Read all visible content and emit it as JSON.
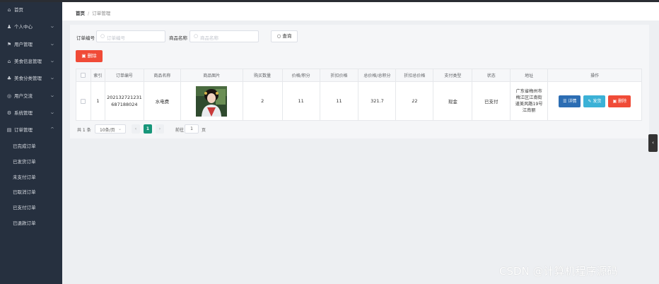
{
  "sidebar": {
    "items": [
      {
        "label": "首页",
        "icon": "home-icon",
        "glyph": "⌂",
        "chevron": ""
      },
      {
        "label": "个人中心",
        "icon": "user-icon",
        "glyph": "♟",
        "chevron": "⌄"
      },
      {
        "label": "用户管理",
        "icon": "flag-icon",
        "glyph": "⚑",
        "chevron": "⌄"
      },
      {
        "label": "美食信息管理",
        "icon": "food-icon",
        "glyph": "⌂",
        "chevron": "⌄"
      },
      {
        "label": "美食分类管理",
        "icon": "category-icon",
        "glyph": "♣",
        "chevron": "⌄"
      },
      {
        "label": "用户交流",
        "icon": "chat-icon",
        "glyph": "◎",
        "chevron": "⌄"
      },
      {
        "label": "系统管理",
        "icon": "settings-icon",
        "glyph": "⚙",
        "chevron": "⌄"
      },
      {
        "label": "订单管理",
        "icon": "order-icon",
        "glyph": "▤",
        "chevron": "⌃"
      }
    ],
    "sub_items": [
      "已完成订单",
      "已发货订单",
      "未支付订单",
      "已取消订单",
      "已支付订单",
      "已退款订单"
    ]
  },
  "breadcrumb": {
    "home": "首页",
    "sep": "/",
    "current": "订单管理"
  },
  "search": {
    "order_no_label": "订单编号",
    "order_no_placeholder": "订单编号",
    "product_label": "商品名称",
    "product_placeholder": "商品名称",
    "query_label": "查询",
    "delete_label": "删除"
  },
  "table": {
    "headers": [
      "",
      "索引",
      "订单编号",
      "商品名称",
      "商品图片",
      "购买数量",
      "价格/积分",
      "折扣价格",
      "总价格/总积分",
      "折扣总价格",
      "支付类型",
      "状态",
      "地址",
      "操作"
    ],
    "rows": [
      {
        "index": "1",
        "order_no": "202132721231687188024",
        "order_no_line1": "202132721231",
        "order_no_line2": "687188024",
        "product": "水电费",
        "quantity": "2",
        "price": "11",
        "discount_price": "11",
        "total": "321.7",
        "discount_total": "22",
        "pay_type": "现金",
        "status": "已支付",
        "address": "广东省梅州市梅江区江南街道美风路19号江南丽",
        "actions": {
          "detail": "详情",
          "ship": "发货",
          "delete": "删除"
        }
      }
    ]
  },
  "pagination": {
    "total": "共 1 条",
    "page_size": "10条/页",
    "prev": "‹",
    "current": "1",
    "next": "›",
    "goto_label": "前往",
    "goto_value": "1",
    "goto_unit": "页"
  },
  "watermark": "CSDN @计算机程序源码",
  "colors": {
    "sidebar_bg": "#26303f",
    "danger": "#f04b37",
    "primary": "#2c6db3",
    "info": "#3bb1d6",
    "page_active": "#17967a"
  }
}
